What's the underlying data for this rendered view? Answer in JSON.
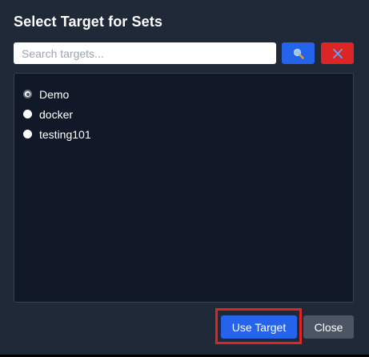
{
  "dialog": {
    "title": "Select Target for Sets"
  },
  "search": {
    "placeholder": "Search targets...",
    "value": "",
    "search_icon": "magnifier-icon",
    "clear_icon": "close-icon"
  },
  "targets": {
    "selected": "Demo",
    "items": [
      {
        "label": "Demo",
        "checked": true
      },
      {
        "label": "docker",
        "checked": false
      },
      {
        "label": "testing101",
        "checked": false
      }
    ]
  },
  "footer": {
    "use_label": "Use Target",
    "close_label": "Close"
  },
  "colors": {
    "background": "#1f2937",
    "list_background": "#111827",
    "primary": "#2563eb",
    "danger": "#dc2626",
    "secondary": "#4b5563",
    "highlight": "#dc2626"
  }
}
